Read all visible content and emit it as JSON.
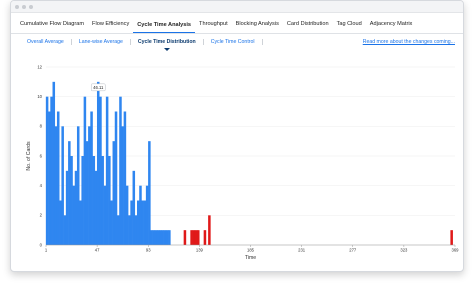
{
  "tabs": [
    {
      "label": "Cumulative Flow Diagram",
      "active": false
    },
    {
      "label": "Flow Efficiency",
      "active": false
    },
    {
      "label": "Cycle Time Analysis",
      "active": true
    },
    {
      "label": "Throughput",
      "active": false
    },
    {
      "label": "Blocking Analysis",
      "active": false
    },
    {
      "label": "Card Distribution",
      "active": false
    },
    {
      "label": "Tag Cloud",
      "active": false
    },
    {
      "label": "Adjacency Matrix",
      "active": false
    }
  ],
  "subtabs": [
    {
      "label": "Overall Average",
      "active": false
    },
    {
      "label": "Lane-wise Average",
      "active": false
    },
    {
      "label": "Cycle Time Distribution",
      "active": true
    },
    {
      "label": "Cycle Time Control",
      "active": false
    }
  ],
  "read_more": "Read more about the changes coming...",
  "tooltip": "46.11",
  "colors": {
    "accent": "#1a73e8",
    "bar_blue": "#2f86f0",
    "bar_red": "#e01919"
  },
  "chart_data": {
    "type": "bar",
    "xlabel": "Time",
    "ylabel": "No. of Cards",
    "xlim": [
      1,
      369
    ],
    "ylim": [
      0,
      12
    ],
    "x_ticks": [
      1,
      47,
      93,
      139,
      185,
      231,
      277,
      323,
      369
    ],
    "y_ticks": [
      0,
      2,
      4,
      6,
      8,
      10,
      12
    ],
    "bin_width": 2,
    "series": [
      {
        "color": "blue",
        "x": [
          1,
          3,
          5,
          7,
          9,
          11,
          13,
          15,
          17,
          19,
          21,
          23,
          25,
          27,
          29,
          31,
          33,
          35,
          37,
          39,
          41,
          43,
          45,
          47,
          49,
          51,
          53,
          55,
          57,
          59,
          61,
          63,
          65,
          67,
          69,
          71,
          73,
          75,
          77,
          79,
          81,
          83,
          85,
          87,
          89,
          91,
          93,
          95,
          97,
          99,
          101,
          103,
          105,
          107,
          109,
          111
        ],
        "values": [
          10,
          9,
          10,
          11,
          8,
          9,
          3,
          8,
          2,
          5,
          7,
          6,
          4,
          5,
          8,
          3,
          6,
          10,
          7,
          8,
          9,
          6,
          5,
          11,
          10,
          6,
          4,
          10,
          6,
          3,
          7,
          9,
          2,
          10,
          8,
          9,
          4,
          2,
          3,
          5,
          2,
          3,
          4,
          3,
          3,
          4,
          7,
          1,
          1,
          1,
          1,
          1,
          1,
          1,
          1,
          1
        ]
      },
      {
        "color": "red",
        "x": [
          125,
          131,
          133,
          135,
          137,
          143,
          147,
          365
        ],
        "values": [
          1,
          1,
          1,
          1,
          1,
          1,
          2,
          1
        ]
      }
    ]
  }
}
